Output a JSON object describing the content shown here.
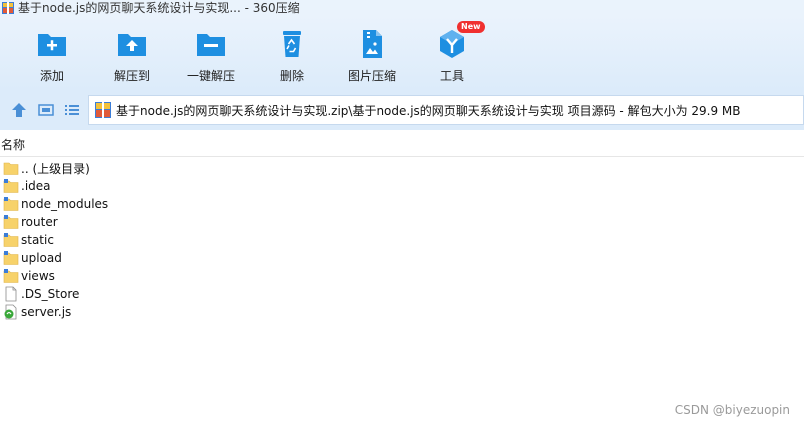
{
  "window": {
    "title": "基于node.js的网页聊天系统设计与实现... - 360压缩"
  },
  "toolbar": {
    "add": "添加",
    "extract_to": "解压到",
    "one_click_extract": "一键解压",
    "delete": "删除",
    "image_compress": "图片压缩",
    "tools": "工具",
    "tools_badge": "New"
  },
  "navbar": {
    "path": "基于node.js的网页聊天系统设计与实现.zip\\基于node.js的网页聊天系统设计与实现 项目源码 - 解包大小为 29.9 MB"
  },
  "list": {
    "column_name": "名称",
    "items": [
      {
        "name": ".. (上级目录)",
        "icon": "folder-icon"
      },
      {
        "name": ".idea",
        "icon": "folder-icon"
      },
      {
        "name": "node_modules",
        "icon": "folder-icon"
      },
      {
        "name": "router",
        "icon": "folder-icon"
      },
      {
        "name": "static",
        "icon": "folder-icon"
      },
      {
        "name": "upload",
        "icon": "folder-icon"
      },
      {
        "name": "views",
        "icon": "folder-icon"
      },
      {
        "name": ".DS_Store",
        "icon": "file-icon"
      },
      {
        "name": "server.js",
        "icon": "js-file-icon"
      }
    ]
  },
  "watermark": "CSDN @biyezuopin",
  "colors": {
    "accent_blue": "#1e8fe1",
    "toolbar_bg": "#dcebfa",
    "folder_yellow": "#f7d26a",
    "badge_red": "#f0302f"
  }
}
